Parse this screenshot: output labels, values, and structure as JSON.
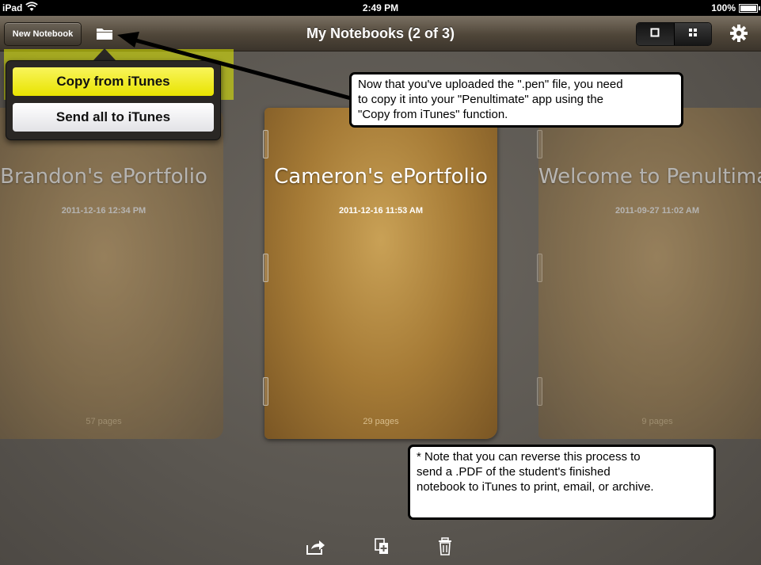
{
  "status_bar": {
    "carrier": "iPad",
    "time": "2:49 PM",
    "battery": "100%"
  },
  "toolbar": {
    "new_notebook_label": "New Notebook",
    "title": "My Notebooks (2 of 3)",
    "folder_icon": "folder-icon",
    "view_single_icon": "single-page-icon",
    "view_grid_icon": "grid-icon",
    "settings_icon": "gear-icon"
  },
  "popover": {
    "copy_label": "Copy from iTunes",
    "send_label": "Send all to iTunes"
  },
  "notebooks": [
    {
      "title": "Brandon's ePortfolio",
      "date": "2011-12-16 12:34 PM",
      "pages": "57 pages"
    },
    {
      "title": "Cameron's ePortfolio",
      "date": "2011-12-16 11:53 AM",
      "pages": "29 pages"
    },
    {
      "title": "Welcome to Penultimate",
      "date": "2011-09-27 11:02 AM",
      "pages": "9 pages"
    }
  ],
  "callouts": {
    "upload_note_line1": "Now that you've uploaded the \".pen\" file, you need",
    "upload_note_line2": "to copy it into your \"Penultimate\" app using the",
    "upload_note_line3": "\"Copy from iTunes\" function.",
    "reverse_note_line1": "* Note that you can reverse this process to",
    "reverse_note_line2": "send a .PDF of the student's finished",
    "reverse_note_line3": "notebook to iTunes to print, email, or archive."
  },
  "bottom_toolbar": {
    "icons": [
      "share-icon",
      "duplicate-icon",
      "trash-icon"
    ]
  },
  "colors": {
    "highlight": "#e6f000",
    "copy_button": "#f3ee2a",
    "toolbar": "#4f4639",
    "background": "#5e5a54"
  }
}
